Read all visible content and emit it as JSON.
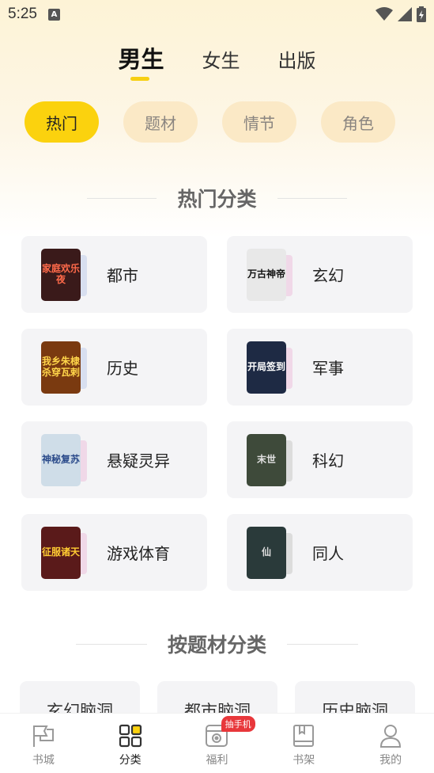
{
  "status_bar": {
    "time": "5:25",
    "notification_letter": "A"
  },
  "top_tabs": [
    {
      "label": "男生",
      "active": true
    },
    {
      "label": "女生",
      "active": false
    },
    {
      "label": "出版",
      "active": false
    }
  ],
  "filter_chips": [
    {
      "label": "热门",
      "active": true
    },
    {
      "label": "题材",
      "active": false
    },
    {
      "label": "情节",
      "active": false
    },
    {
      "label": "角色",
      "active": false
    }
  ],
  "hot_section": {
    "title": "热门分类"
  },
  "categories": [
    {
      "label": "都市",
      "cover_text": "家庭欢乐夜",
      "cover_bg": "#3a1a1a",
      "cover_fg": "#ff6a4a",
      "back_color": "#d8dff0"
    },
    {
      "label": "玄幻",
      "cover_text": "万古神帝",
      "cover_bg": "#e8e8e8",
      "cover_fg": "#111111",
      "back_color": "#f0d8e8"
    },
    {
      "label": "历史",
      "cover_text": "我乡朱棣杀穿瓦剌",
      "cover_bg": "#7a3a10",
      "cover_fg": "#ffd54a",
      "back_color": "#d8dff0"
    },
    {
      "label": "军事",
      "cover_text": "开局签到",
      "cover_bg": "#1e2a44",
      "cover_fg": "#ffffff",
      "back_color": "#f0d8e8"
    },
    {
      "label": "悬疑灵异",
      "cover_text": "神秘复苏",
      "cover_bg": "#cfdde8",
      "cover_fg": "#2a4a8a",
      "back_color": "#f0d8e8"
    },
    {
      "label": "科幻",
      "cover_text": "末世",
      "cover_bg": "#3e4a3a",
      "cover_fg": "#e0e0e0",
      "back_color": "#dcdcdc"
    },
    {
      "label": "游戏体育",
      "cover_text": "征服诸天",
      "cover_bg": "#5a1a1a",
      "cover_fg": "#ffcc33",
      "back_color": "#f0d8e8"
    },
    {
      "label": "同人",
      "cover_text": "仙",
      "cover_bg": "#2a3a3a",
      "cover_fg": "#dddddd",
      "back_color": "#dcdcdc"
    }
  ],
  "topic_section": {
    "title": "按题材分类"
  },
  "topics": [
    "玄幻脑洞",
    "都市脑洞",
    "历史脑洞"
  ],
  "bottom_nav": [
    {
      "label": "书城",
      "icon": "bookstore-flag-icon",
      "active": false
    },
    {
      "label": "分类",
      "icon": "category-grid-icon",
      "active": true
    },
    {
      "label": "福利",
      "icon": "welfare-icon",
      "active": false,
      "badge": "抽手机"
    },
    {
      "label": "书架",
      "icon": "bookshelf-icon",
      "active": false
    },
    {
      "label": "我的",
      "icon": "profile-icon",
      "active": false
    }
  ],
  "colors": {
    "accent": "#fbd20e",
    "chip_bg": "#fbe9c6",
    "card_bg": "#f4f4f6",
    "badge": "#e8373b"
  }
}
